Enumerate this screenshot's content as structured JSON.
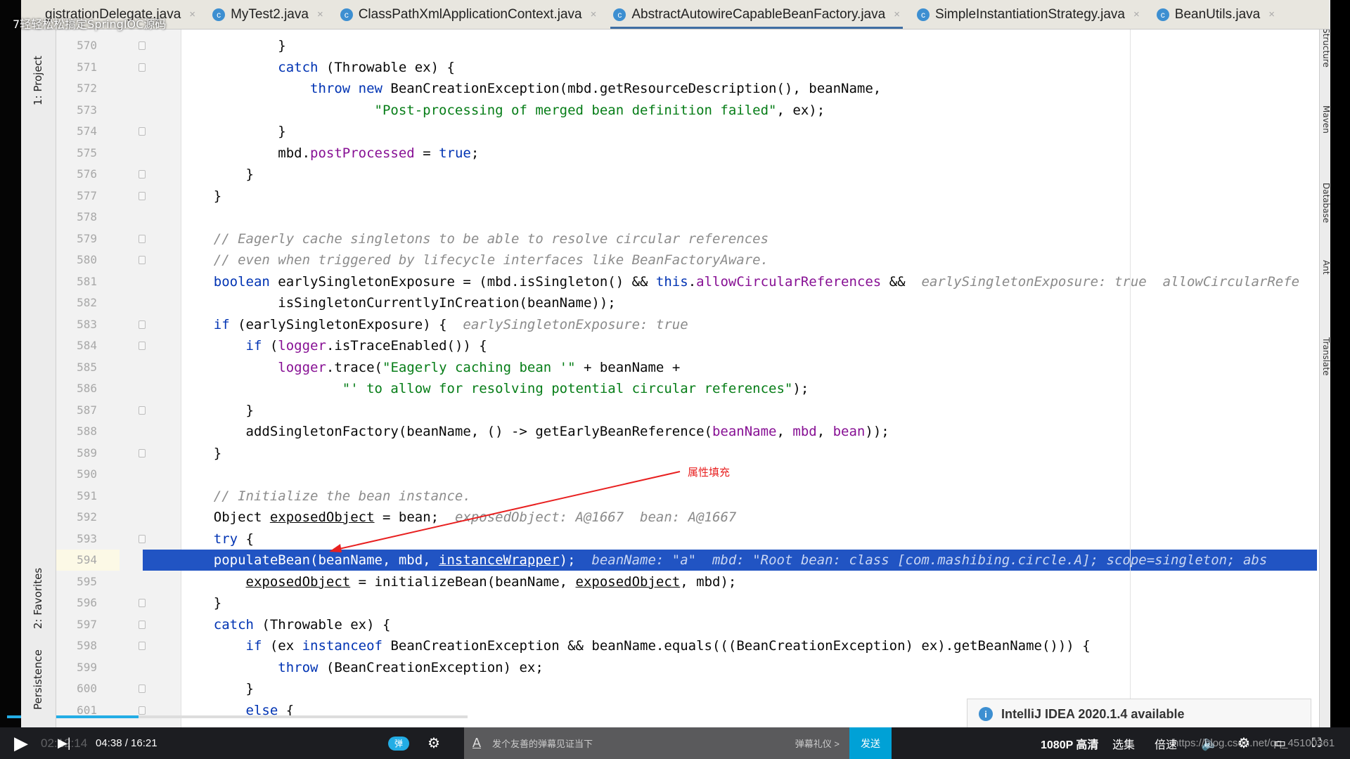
{
  "video_title": "7轻轻松松搞定SpringIOC源码",
  "tabs": [
    {
      "label": "gistrationDelegate.java",
      "active": false
    },
    {
      "label": "MyTest2.java",
      "active": false
    },
    {
      "label": "ClassPathXmlApplicationContext.java",
      "active": false
    },
    {
      "label": "AbstractAutowireCapableBeanFactory.java",
      "active": true
    },
    {
      "label": "SimpleInstantiationStrategy.java",
      "active": false
    },
    {
      "label": "BeanUtils.java",
      "active": false
    }
  ],
  "left_tools": [
    "1: Project",
    "2: Favorites",
    "Persistence"
  ],
  "right_tools": [
    "Structure",
    "Maven",
    "Database",
    "Ant",
    "Translate"
  ],
  "highlight_line": 594,
  "code_lines": [
    {
      "n": 570,
      "t": [
        [
          "            }",
          ""
        ]
      ]
    },
    {
      "n": 571,
      "t": [
        [
          "            ",
          ""
        ],
        [
          "catch",
          "kw"
        ],
        [
          " (Throwable ex) {",
          ""
        ]
      ]
    },
    {
      "n": 572,
      "t": [
        [
          "                ",
          ""
        ],
        [
          "throw new",
          "kw"
        ],
        [
          " BeanCreationException(mbd.getResourceDescription(), beanName,",
          ""
        ]
      ]
    },
    {
      "n": 573,
      "t": [
        [
          "                        ",
          ""
        ],
        [
          "\"Post-processing of merged bean definition failed\"",
          "str"
        ],
        [
          ", ex);",
          ""
        ]
      ]
    },
    {
      "n": 574,
      "t": [
        [
          "            }",
          ""
        ]
      ]
    },
    {
      "n": 575,
      "t": [
        [
          "            mbd.",
          ""
        ],
        [
          "postProcessed",
          "fld"
        ],
        [
          " = ",
          ""
        ],
        [
          "true",
          "kw"
        ],
        [
          ";",
          ""
        ]
      ]
    },
    {
      "n": 576,
      "t": [
        [
          "        }",
          ""
        ]
      ]
    },
    {
      "n": 577,
      "t": [
        [
          "    }",
          ""
        ]
      ]
    },
    {
      "n": 578,
      "t": []
    },
    {
      "n": 579,
      "t": [
        [
          "    ",
          ""
        ],
        [
          "// Eagerly cache singletons to be able to resolve circular references",
          "cm"
        ]
      ]
    },
    {
      "n": 580,
      "t": [
        [
          "    ",
          ""
        ],
        [
          "// even when triggered by lifecycle interfaces like BeanFactoryAware.",
          "cm"
        ]
      ]
    },
    {
      "n": 581,
      "t": [
        [
          "    ",
          ""
        ],
        [
          "boolean",
          "kw"
        ],
        [
          " earlySingletonExposure = (mbd.isSingleton() && ",
          ""
        ],
        [
          "this",
          "kw"
        ],
        [
          ".",
          ""
        ],
        [
          "allowCircularReferences",
          "fld"
        ],
        [
          " &&",
          ""
        ],
        [
          "  earlySingletonExposure: true  allowCircularRefe",
          "hint"
        ]
      ]
    },
    {
      "n": 582,
      "t": [
        [
          "            isSingletonCurrentlyInCreation(beanName));",
          ""
        ]
      ]
    },
    {
      "n": 583,
      "t": [
        [
          "    ",
          ""
        ],
        [
          "if",
          "kw"
        ],
        [
          " (earlySingletonExposure) {",
          ""
        ],
        [
          "  earlySingletonExposure: true",
          "hint"
        ]
      ]
    },
    {
      "n": 584,
      "t": [
        [
          "        ",
          ""
        ],
        [
          "if",
          "kw"
        ],
        [
          " (",
          ""
        ],
        [
          "logger",
          "fld"
        ],
        [
          ".isTraceEnabled()) {",
          ""
        ]
      ]
    },
    {
      "n": 585,
      "t": [
        [
          "            ",
          ""
        ],
        [
          "logger",
          "fld"
        ],
        [
          ".trace(",
          ""
        ],
        [
          "\"Eagerly caching bean '\"",
          "str"
        ],
        [
          " + beanName +",
          ""
        ]
      ]
    },
    {
      "n": 586,
      "t": [
        [
          "                    ",
          ""
        ],
        [
          "\"' to allow for resolving potential circular references\"",
          "str"
        ],
        [
          ");",
          ""
        ]
      ]
    },
    {
      "n": 587,
      "t": [
        [
          "        }",
          ""
        ]
      ]
    },
    {
      "n": 588,
      "t": [
        [
          "        addSingletonFactory(beanName, () -> getEarlyBeanReference(",
          ""
        ],
        [
          "beanName",
          "fld"
        ],
        [
          ", ",
          ""
        ],
        [
          "mbd",
          "fld"
        ],
        [
          ", ",
          ""
        ],
        [
          "bean",
          "fld"
        ],
        [
          "));",
          ""
        ]
      ]
    },
    {
      "n": 589,
      "t": [
        [
          "    }",
          ""
        ]
      ]
    },
    {
      "n": 590,
      "t": []
    },
    {
      "n": 591,
      "t": [
        [
          "    ",
          ""
        ],
        [
          "// Initialize the bean instance.",
          "cm"
        ]
      ]
    },
    {
      "n": 592,
      "t": [
        [
          "    Object ",
          ""
        ],
        [
          "exposedObject",
          "ul"
        ],
        [
          " = bean;",
          ""
        ],
        [
          "  exposedObject: A@1667  bean: A@1667",
          "hint"
        ]
      ]
    },
    {
      "n": 593,
      "t": [
        [
          "    ",
          ""
        ],
        [
          "try",
          "kw"
        ],
        [
          " {",
          ""
        ]
      ]
    },
    {
      "n": 594,
      "t": [
        [
          "    populateBean(beanName, mbd, ",
          ""
        ],
        [
          "instanceWrapper",
          "ul"
        ],
        [
          ");",
          ""
        ],
        [
          "  beanName: \"a\"  mbd: \"Root bean: class [com.mashibing.circle.A]; scope=singleton; abs",
          "hint"
        ]
      ]
    },
    {
      "n": 595,
      "t": [
        [
          "        ",
          ""
        ],
        [
          "exposedObject",
          "ul"
        ],
        [
          " = initializeBean(beanName, ",
          ""
        ],
        [
          "exposedObject",
          "ul"
        ],
        [
          ", mbd);",
          ""
        ]
      ]
    },
    {
      "n": 596,
      "t": [
        [
          "    }",
          ""
        ]
      ]
    },
    {
      "n": 597,
      "t": [
        [
          "    ",
          ""
        ],
        [
          "catch",
          "kw"
        ],
        [
          " (Throwable ex) {",
          ""
        ]
      ]
    },
    {
      "n": 598,
      "t": [
        [
          "        ",
          ""
        ],
        [
          "if",
          "kw"
        ],
        [
          " (ex ",
          ""
        ],
        [
          "instanceof",
          "kw"
        ],
        [
          " BeanCreationException && beanName.equals(((BeanCreationException) ex).getBeanName())) {",
          ""
        ]
      ]
    },
    {
      "n": 599,
      "t": [
        [
          "            ",
          ""
        ],
        [
          "throw",
          "kw"
        ],
        [
          " (BeanCreationException) ex;",
          ""
        ]
      ]
    },
    {
      "n": 600,
      "t": [
        [
          "        }",
          ""
        ]
      ]
    },
    {
      "n": 601,
      "t": [
        [
          "        ",
          ""
        ],
        [
          "else",
          "kw"
        ],
        [
          " {",
          ""
        ]
      ]
    }
  ],
  "fold_lines": [
    570,
    571,
    574,
    576,
    577,
    579,
    580,
    583,
    584,
    587,
    589,
    593,
    596,
    597,
    598,
    600,
    601
  ],
  "annotation": {
    "text": "属性填充",
    "color": "#e82020"
  },
  "notification": {
    "text": "IntelliJ IDEA 2020.1.4 available"
  },
  "player": {
    "time": "04:38 / 16:21",
    "progress_percent": 28.6,
    "overlay_time": "02:12:14",
    "danmaku_placeholder": "发个友善的弹幕见证当下",
    "danmaku_etiquette": "弹幕礼仪 >",
    "send": "发送",
    "quality": "1080P 高清",
    "episodes": "选集",
    "speed": "倍速",
    "watermark": "https://blog.csdn.net/qq_45100361"
  },
  "colors": {
    "selection": "#2154c3",
    "accent": "#00a1d6"
  }
}
